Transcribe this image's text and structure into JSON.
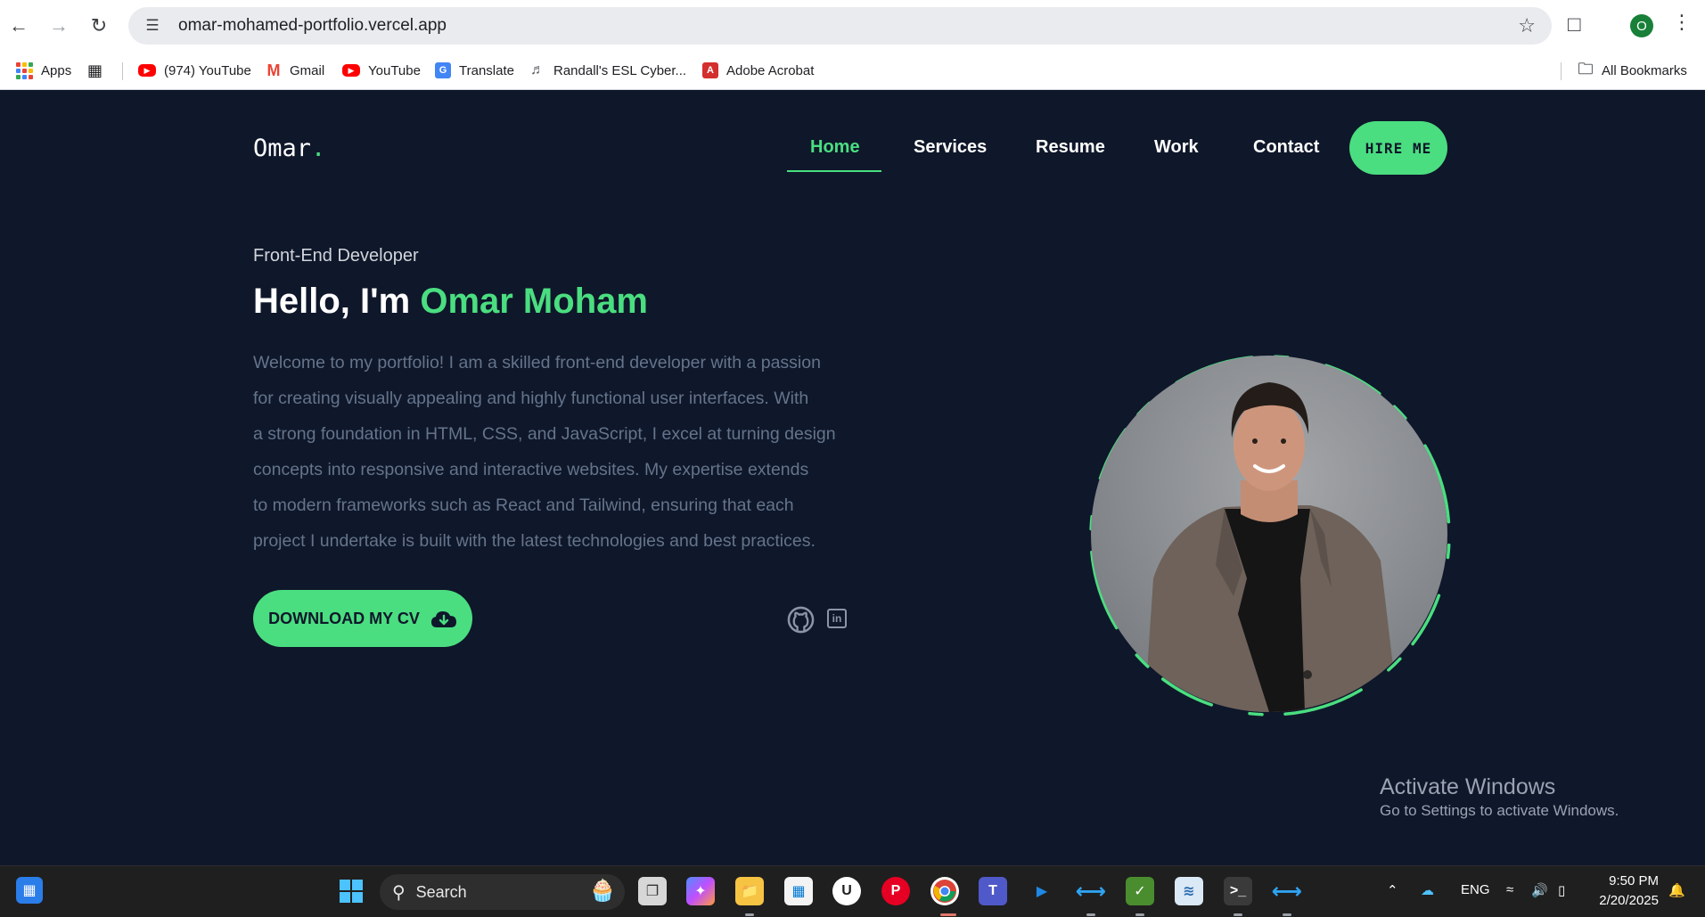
{
  "browser": {
    "url": "omar-mohamed-portfolio.vercel.app",
    "profile_initial": "O",
    "bookmarks": [
      {
        "label": "Apps",
        "icon": "apps-grid-icon"
      },
      {
        "label": "(974) YouTube",
        "icon": "youtube-icon"
      },
      {
        "label": "Gmail",
        "icon": "gmail-icon"
      },
      {
        "label": "YouTube",
        "icon": "youtube-icon"
      },
      {
        "label": "Translate",
        "icon": "translate-icon"
      },
      {
        "label": "Randall's ESL Cyber...",
        "icon": "headphones-icon"
      },
      {
        "label": "Adobe Acrobat",
        "icon": "acrobat-icon"
      }
    ],
    "all_bookmarks": "All Bookmarks"
  },
  "site": {
    "logo": "Omar",
    "logo_dot": ".",
    "nav": [
      "Home",
      "Services",
      "Resume",
      "Work",
      "Contact"
    ],
    "active_nav": "Home",
    "hire_label": "HIRE ME",
    "role": "Front-End Developer",
    "hello_prefix": "Hello, I'm ",
    "hello_name": "Omar Moham",
    "bio_lines": [
      "Welcome to my portfolio! I am a skilled front-end developer with a passion",
      "for creating visually appealing and highly functional user interfaces. With",
      "a strong foundation in HTML, CSS, and JavaScript, I excel at turning design",
      "concepts into responsive and interactive websites. My expertise extends",
      "to modern frameworks such as React and Tailwind, ensuring that each",
      "project I undertake is built with the latest technologies and best practices."
    ],
    "cv_label": "DOWNLOAD MY CV",
    "social": [
      "github-icon",
      "linkedin-icon"
    ],
    "accent_color": "#4ade80",
    "background_color": "#0f172a"
  },
  "windows_notice": {
    "title": "Activate Windows",
    "subtitle": "Go to Settings to activate Windows."
  },
  "taskbar": {
    "search_label": "Search",
    "language": "ENG",
    "time": "9:50 PM",
    "date": "2/20/2025"
  }
}
